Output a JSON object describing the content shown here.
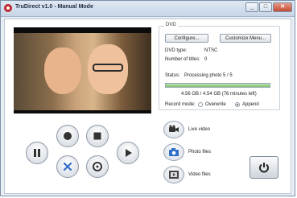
{
  "window": {
    "title": "TruDirect v1.0 - Manual Mode",
    "min": "_",
    "max": "□",
    "close": "✕"
  },
  "dvd": {
    "legend": "DVD",
    "configure": "Configure...",
    "customize_menu": "Customize Menu...",
    "dvd_type_label": "DVD type:",
    "dvd_type_value": "NTSC",
    "num_titles_label": "Number of titles:",
    "num_titles_value": "0",
    "status_label": "Status:",
    "status_value": "Processing photo 5 / 5",
    "progress_fraction": 1.0,
    "space_text": "4.56 GB / 4.54 GB (76 minutes left)",
    "record_mode_label": "Record mode:",
    "overwrite_label": "Overwrite",
    "append_label": "Append",
    "selected_mode": "append"
  },
  "side": {
    "live_video": "Live video",
    "photo_files": "Photo files",
    "video_files": "Video files"
  },
  "icons": {
    "record": "record-icon",
    "stop": "stop-icon",
    "pause": "pause-icon",
    "play": "play-icon",
    "cancel": "cancel-icon",
    "disc": "disc-icon",
    "camera": "video-camera-icon",
    "photo": "photo-camera-icon",
    "film": "film-icon",
    "power": "power-icon"
  },
  "colors": {
    "accent_blue": "#2f6fc7",
    "progress_green": "#7cc36d",
    "close_red": "#c24a32"
  }
}
